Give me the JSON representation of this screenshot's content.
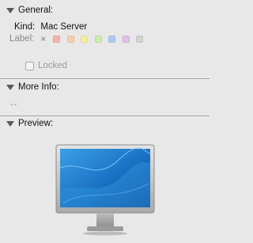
{
  "general": {
    "title": "General:",
    "kind_label": "Kind:",
    "kind_value": "Mac Server",
    "label_caption": "Label:",
    "label_none_symbol": "×",
    "label_colors": [
      "#f4b3ad",
      "#f7ceab",
      "#f3ef9d",
      "#cdeca8",
      "#aacbf1",
      "#e3bfe9",
      "#d3d3d3"
    ],
    "locked_label": "Locked",
    "locked_checked": false
  },
  "more_info": {
    "title": "More Info:",
    "value": "--"
  },
  "preview": {
    "title": "Preview:",
    "icon": "cinema-display-icon"
  }
}
